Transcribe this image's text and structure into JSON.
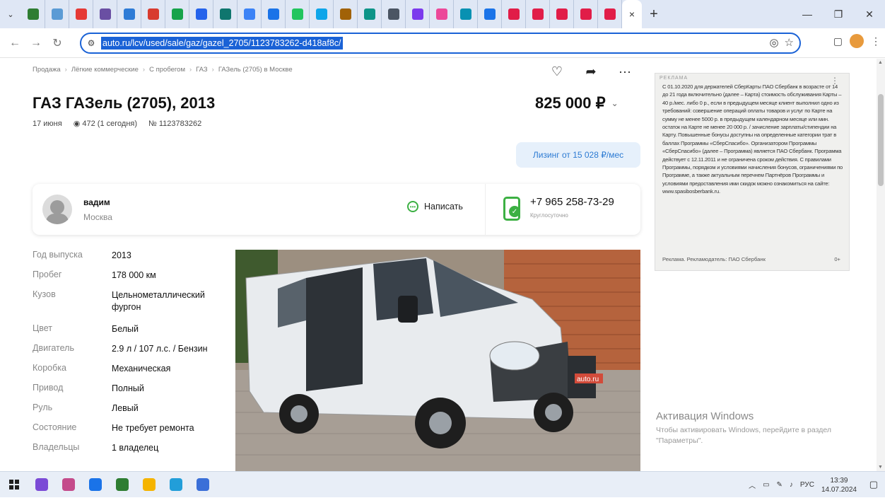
{
  "browser": {
    "tab_list_icon": "chevron-down-icon",
    "tab_favicon_colors": [
      "#2e7d32",
      "#5b9bd5",
      "#e53935",
      "#6a4fa3",
      "#2e7bd6",
      "#d83b2f",
      "#16a34a",
      "#2563eb",
      "#0f766e",
      "#3b82f6",
      "#1a73e8",
      "#22c55e",
      "#0ea5e9",
      "#a16207",
      "#0d9488",
      "#4b5563",
      "#7c3aed",
      "#ec4899",
      "#0891b2",
      "#1a73e8",
      "#e11d48",
      "#e11d48",
      "#e11d48",
      "#e11d48",
      "#e11d48"
    ],
    "active_tab_close": "×",
    "new_tab": "+",
    "window": {
      "minimize": "—",
      "restore": "❐",
      "close": "✕"
    },
    "url": "auto.ru/lcv/used/sale/gaz/gazel_2705/1123783262-d418af8c/",
    "accent": "#1a62d6"
  },
  "listing": {
    "breadcrumb": [
      "Продажа",
      "Лёгкие коммерческие",
      "С пробегом",
      "ГАЗ",
      "ГАЗель (2705) в Москве"
    ],
    "title": "ГАЗ ГАЗель (2705), 2013",
    "date": "17 июня",
    "views": "472 (1 сегодня)",
    "number": "№ 1123783262",
    "price": "825 000 ₽",
    "leasing": "Лизинг от 15 028 ₽/мес",
    "seller": {
      "name": "вадим",
      "city": "Москва",
      "write_label": "Написать",
      "phone": "+7 965 258-73-29",
      "phone_note": "Круглосуточно"
    },
    "specs": [
      {
        "label": "Год выпуска",
        "value": "2013"
      },
      {
        "label": "Пробег",
        "value": "178 000 км"
      },
      {
        "label": "Кузов",
        "value": "Цельнометаллический фургон"
      },
      {
        "label": "Цвет",
        "value": "Белый"
      },
      {
        "label": "Двигатель",
        "value": "2.9 л / 107 л.с. / Бензин"
      },
      {
        "label": "Коробка",
        "value": "Механическая"
      },
      {
        "label": "Привод",
        "value": "Полный"
      },
      {
        "label": "Руль",
        "value": "Левый"
      },
      {
        "label": "Состояние",
        "value": "Не требует ремонта"
      },
      {
        "label": "Владельцы",
        "value": "1 владелец"
      }
    ],
    "photo_watermark": "auto.ru"
  },
  "ad": {
    "label": "РЕКЛАМА",
    "text": "С 01.10.2020 для держателей СберКарты ПАО Сбербанк в возрасте от 14 до 21 года включительно (далее – Карта) стоимость обслуживания Карты – 40 р./мес. либо 0 р., если в предыдущем месяце клиент выполнил одно из требований: совершение операций оплаты товаров и услуг по Карте на сумму не менее 5000 р. в предыдущем календарном месяце или мин. остаток на Карте не менее 20 000 р. / зачисление зарплаты/стипендии на Карту. Повышенные бонусы доступны на определенные категории трат в баллах Программы «СберСпасибо». Организатором Программы «СберСпасибо» (далее – Программа) является ПАО Сбербанк. Программа действует с 12.11.2011 и не ограничена сроком действия. С правилами Программы, порядком и условиями начисления бонусов, ограничениями по Программе, а также актуальным перечнем Партнёров Программы и условиями предоставления ими скидок можно ознакомиться на сайте: www.spasibosberbank.ru.",
    "footer": "Реклама. Рекламодатель: ПАО Сбербанк",
    "age": "0+"
  },
  "windows": {
    "activation_title": "Активация Windows",
    "activation_text": "Чтобы активировать Windows, перейдите в раздел \"Параметры\"."
  },
  "taskbar": {
    "apps": [
      "#7b4bd6",
      "#c44b8b",
      "#1a73e8",
      "#2e7d32",
      "#f5b400",
      "#229ed9",
      "#3a6fd8"
    ],
    "lang": "РУС",
    "time": "13:39",
    "date": "14.07.2024"
  }
}
